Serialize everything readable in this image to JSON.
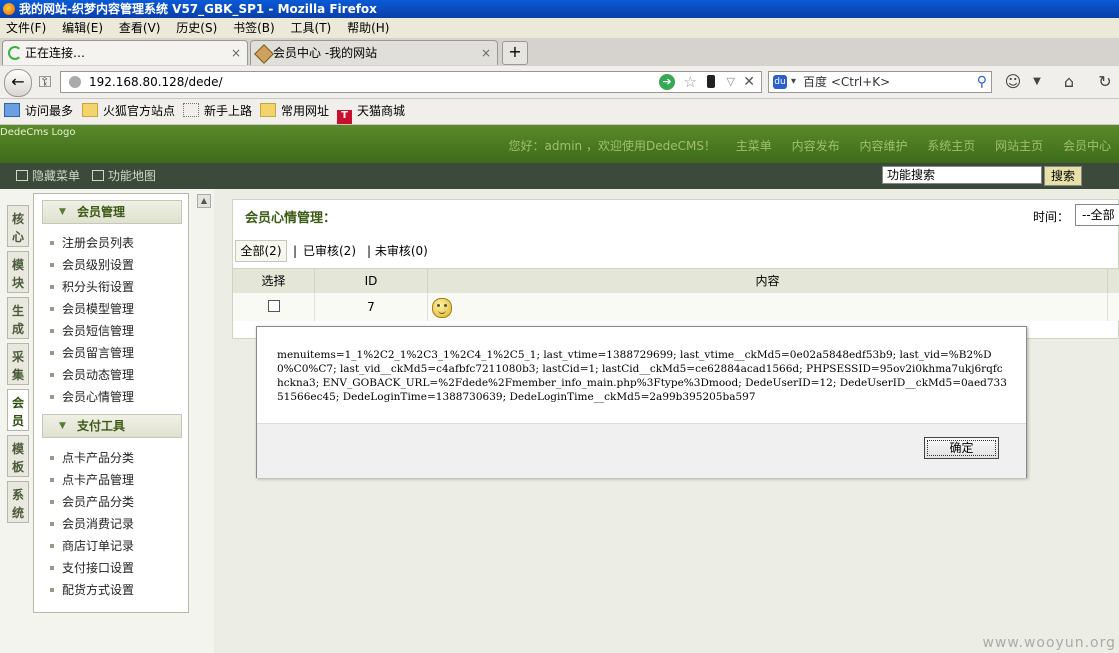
{
  "window": {
    "title": "我的网站-织梦内容管理系统 V57_GBK_SP1 - Mozilla Firefox"
  },
  "menubar": [
    "文件(F)",
    "编辑(E)",
    "查看(V)",
    "历史(S)",
    "书签(B)",
    "工具(T)",
    "帮助(H)"
  ],
  "tabs": [
    {
      "label": "正在连接…",
      "close": "×"
    },
    {
      "label": "会员中心 -我的网站",
      "close": "×"
    }
  ],
  "newtab": "+",
  "nav": {
    "url": "192.168.80.128/dede/",
    "search_placeholder": "百度 <Ctrl+K>",
    "back": "←",
    "home": "⌂",
    "reload": "↻"
  },
  "bookmarks": [
    "访问最多",
    "火狐官方站点",
    "新手上路",
    "常用网址",
    "天猫商城"
  ],
  "header": {
    "logo": "DedeCms Logo",
    "greeting": "您好：admin ，欢迎使用DedeCMS！",
    "links": [
      "主菜单",
      "内容发布",
      "内容维护",
      "系统主页",
      "网站主页",
      "会员中心"
    ]
  },
  "toolbar": {
    "hide_menu": "隐藏菜单",
    "function_map": "功能地图",
    "search_value": "功能搜索",
    "search_button": "搜索"
  },
  "vtabs": [
    {
      "label": "核心",
      "active": false
    },
    {
      "label": "模块",
      "active": false
    },
    {
      "label": "生成",
      "active": false
    },
    {
      "label": "采集",
      "active": false
    },
    {
      "label": "会员",
      "active": true
    },
    {
      "label": "模板",
      "active": false
    },
    {
      "label": "系统",
      "active": false
    }
  ],
  "menu": {
    "group1": {
      "title": "会员管理",
      "items": [
        "注册会员列表",
        "会员级别设置",
        "积分头衔设置",
        "会员模型管理",
        "会员短信管理",
        "会员留言管理",
        "会员动态管理",
        "会员心情管理"
      ]
    },
    "group2": {
      "title": "支付工具",
      "items": [
        "点卡产品分类",
        "点卡产品管理",
        "会员产品分类",
        "会员消费记录",
        "商店订单记录",
        "支付接口设置",
        "配货方式设置"
      ]
    }
  },
  "main": {
    "title": "会员心情管理：",
    "time_label": "时间：",
    "time_value": "--全部",
    "filters": {
      "all": "全部(2)",
      "sep": "|",
      "checked": "已审核(2)",
      "unchecked": "| 未审核(0)"
    },
    "columns": [
      "选择",
      "ID",
      "内容"
    ],
    "rows": [
      {
        "id": "7"
      }
    ]
  },
  "dialog": {
    "message": "menuitems=1_1%2C2_1%2C3_1%2C4_1%2C5_1; last_vtime=1388729699; last_vtime__ckMd5=0e02a5848edf53b9; last_vid=%B2%D0%C0%C7; last_vid__ckMd5=c4afbfc7211080b3; lastCid=1; lastCid__ckMd5=ce62884acad1566d; PHPSESSID=95ov2i0khma7ukj6rqfchckna3; ENV_GOBACK_URL=%2Fdede%2Fmember_info_main.php%3Ftype%3Dmood; DedeUserID=12; DedeUserID__ckMd5=0aed73351566ec45; DedeLoginTime=1388730639; DedeLoginTime__ckMd5=2a99b395205ba597",
    "ok": "确定"
  },
  "watermark": "www.wooyun.org"
}
